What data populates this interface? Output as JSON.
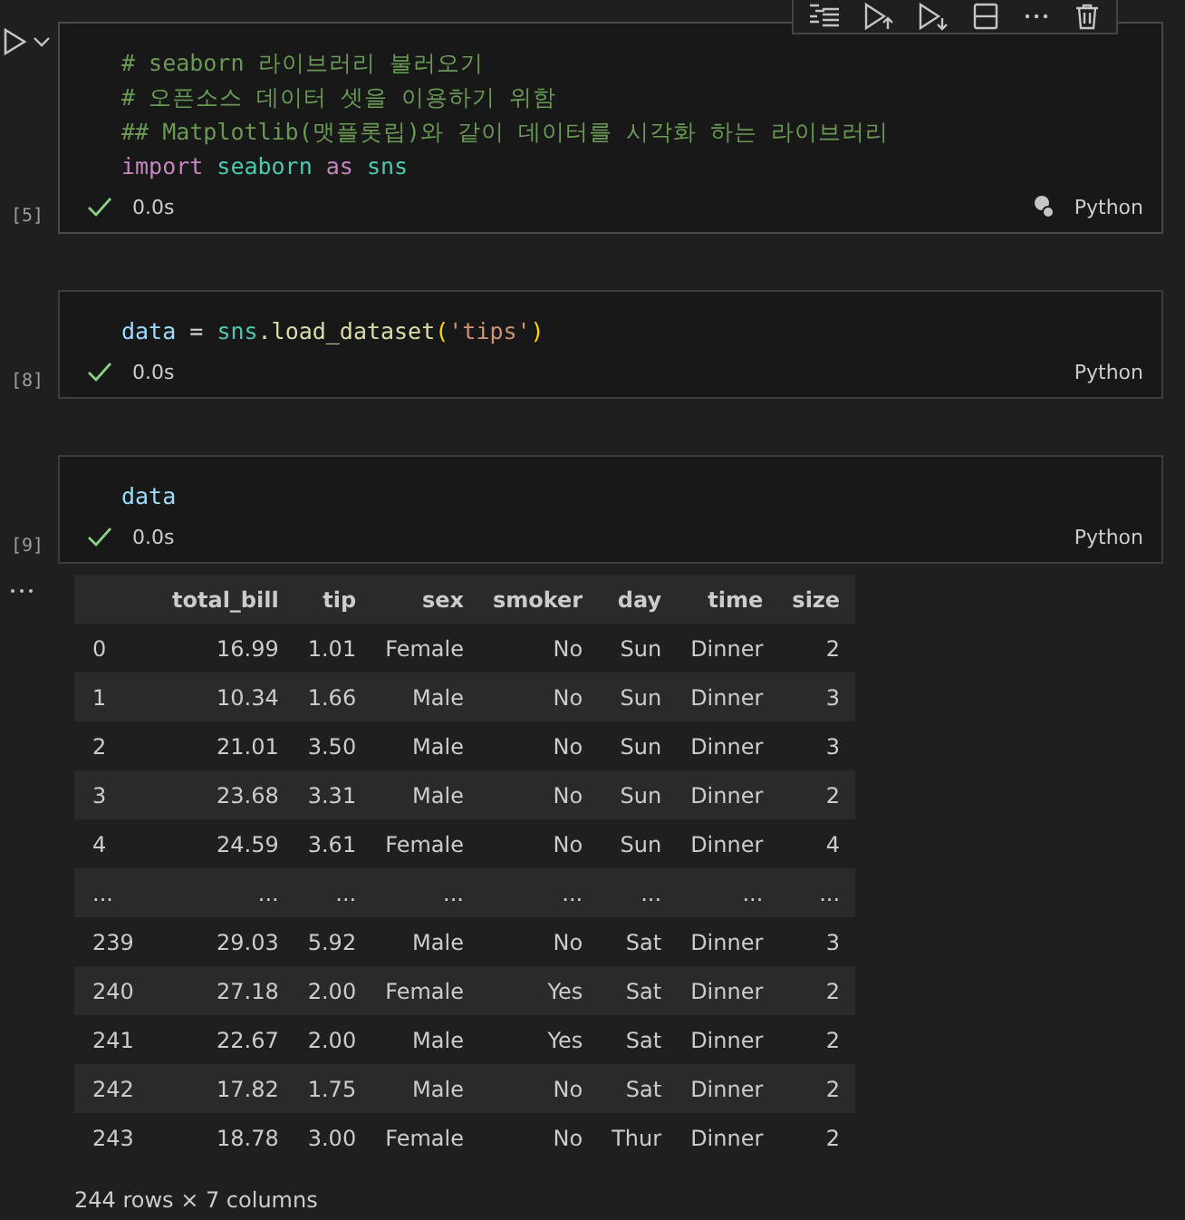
{
  "cells": [
    {
      "focused": true,
      "execution_count": "[5]",
      "lines": [
        [
          {
            "t": "# seaborn 라이브러리 불러오기",
            "kind": "comment"
          }
        ],
        [
          {
            "t": "# 오픈소스 데이터 셋을 이용하기 위함",
            "kind": "comment"
          }
        ],
        [
          {
            "t": "## Matplotlib(맷플롯립)와 같이 데이터를 시각화 하는 라이브러리",
            "kind": "comment"
          }
        ],
        [
          {
            "t": "import",
            "kind": "keyword"
          },
          {
            "t": " seaborn",
            "kind": "module"
          },
          {
            "t": " as",
            "kind": "keyword"
          },
          {
            "t": " sns",
            "kind": "module"
          }
        ]
      ],
      "status": {
        "succeeded": true,
        "time": "0.0s",
        "language": "Python"
      }
    },
    {
      "focused": false,
      "execution_count": "[8]",
      "lines": [
        [
          {
            "t": "data",
            "kind": "variable"
          },
          {
            "t": " = ",
            "kind": "plain"
          },
          {
            "t": "sns",
            "kind": "module"
          },
          {
            "t": ".load_dataset",
            "kind": "func"
          },
          {
            "t": "(",
            "kind": "paren"
          },
          {
            "t": "'tips'",
            "kind": "string"
          },
          {
            "t": ")",
            "kind": "paren"
          }
        ]
      ],
      "status": {
        "succeeded": true,
        "time": "0.0s",
        "language": "Python"
      }
    },
    {
      "focused": false,
      "execution_count": "[9]",
      "lines": [
        [
          {
            "t": "data",
            "kind": "variable"
          }
        ]
      ],
      "status": {
        "succeeded": true,
        "time": "0.0s",
        "language": "Python"
      }
    }
  ],
  "output": {
    "table": {
      "columns": [
        "total_bill",
        "tip",
        "sex",
        "smoker",
        "day",
        "time",
        "size"
      ],
      "rows": [
        {
          "index": "0",
          "cells": [
            "16.99",
            "1.01",
            "Female",
            "No",
            "Sun",
            "Dinner",
            "2"
          ]
        },
        {
          "index": "1",
          "cells": [
            "10.34",
            "1.66",
            "Male",
            "No",
            "Sun",
            "Dinner",
            "3"
          ]
        },
        {
          "index": "2",
          "cells": [
            "21.01",
            "3.50",
            "Male",
            "No",
            "Sun",
            "Dinner",
            "3"
          ]
        },
        {
          "index": "3",
          "cells": [
            "23.68",
            "3.31",
            "Male",
            "No",
            "Sun",
            "Dinner",
            "2"
          ]
        },
        {
          "index": "4",
          "cells": [
            "24.59",
            "3.61",
            "Female",
            "No",
            "Sun",
            "Dinner",
            "4"
          ]
        },
        {
          "index": "...",
          "cells": [
            "...",
            "...",
            "...",
            "...",
            "...",
            "...",
            "..."
          ]
        },
        {
          "index": "239",
          "cells": [
            "29.03",
            "5.92",
            "Male",
            "No",
            "Sat",
            "Dinner",
            "3"
          ]
        },
        {
          "index": "240",
          "cells": [
            "27.18",
            "2.00",
            "Female",
            "Yes",
            "Sat",
            "Dinner",
            "2"
          ]
        },
        {
          "index": "241",
          "cells": [
            "22.67",
            "2.00",
            "Male",
            "Yes",
            "Sat",
            "Dinner",
            "2"
          ]
        },
        {
          "index": "242",
          "cells": [
            "17.82",
            "1.75",
            "Male",
            "No",
            "Sat",
            "Dinner",
            "2"
          ]
        },
        {
          "index": "243",
          "cells": [
            "18.78",
            "3.00",
            "Female",
            "No",
            "Thur",
            "Dinner",
            "2"
          ]
        }
      ]
    },
    "shape": "244 rows × 7 columns"
  }
}
